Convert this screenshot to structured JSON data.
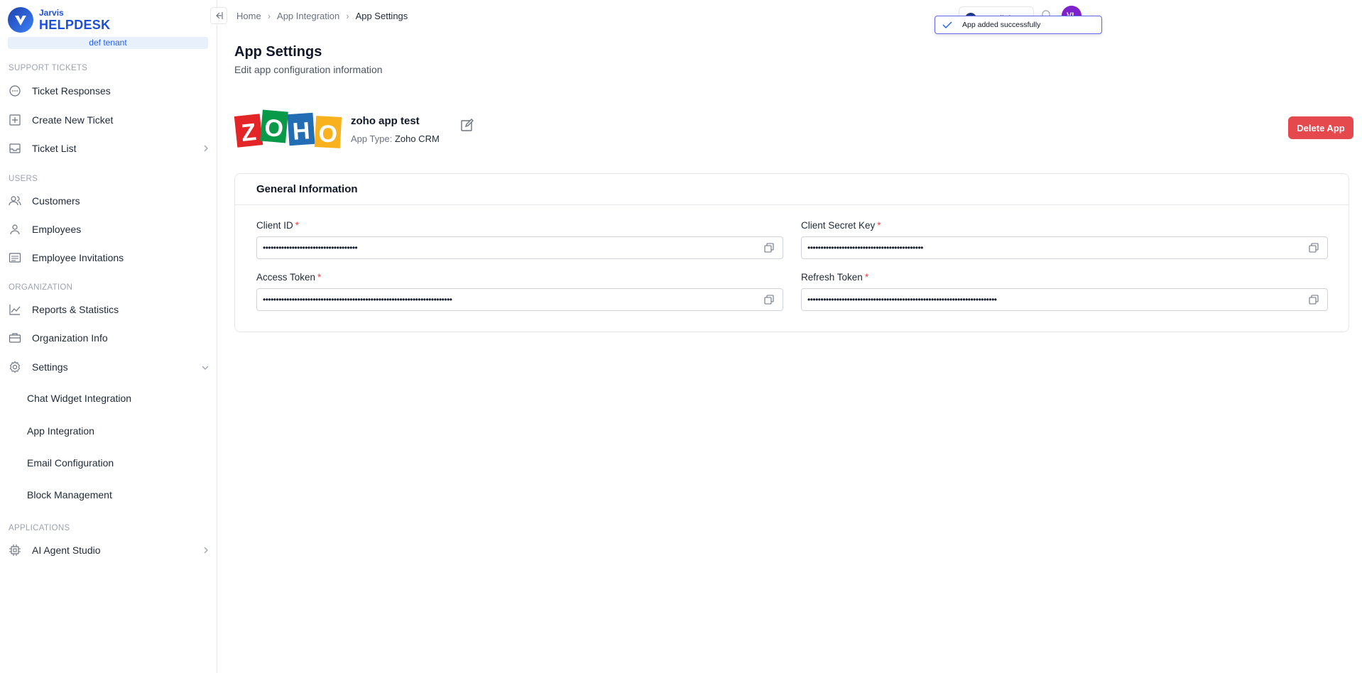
{
  "brand": {
    "small": "Jarvis",
    "big": "HELPDESK",
    "tenant": "def tenant"
  },
  "sidebar": {
    "sections": [
      "SUPPORT TICKETS",
      "USERS",
      "ORGANIZATION",
      "APPLICATIONS"
    ],
    "items": [
      {
        "label": "Ticket Responses",
        "icon": "chat-icon"
      },
      {
        "label": "Create New Ticket",
        "icon": "plus-square-icon"
      },
      {
        "label": "Ticket List",
        "icon": "inbox-icon"
      },
      {
        "label": "Customers",
        "icon": "users-icon"
      },
      {
        "label": "Employees",
        "icon": "user-icon"
      },
      {
        "label": "Employee Invitations",
        "icon": "list-icon"
      },
      {
        "label": "Reports & Statistics",
        "icon": "chart-line-icon"
      },
      {
        "label": "Organization Info",
        "icon": "briefcase-icon"
      },
      {
        "label": "Settings",
        "icon": "gear-icon"
      },
      {
        "label": "AI Agent Studio",
        "icon": "chip-icon"
      }
    ],
    "settings_sub": [
      "Chat Widget Integration",
      "App Integration",
      "Email Configuration",
      "Block Management"
    ]
  },
  "breadcrumb": {
    "home": "Home",
    "parent": "App Integration",
    "current": "App Settings"
  },
  "header": {
    "title": "App Settings",
    "subtitle": "Edit app configuration information"
  },
  "app": {
    "name": "zoho app test",
    "type_key": "App Type:",
    "type_value": "Zoho CRM",
    "delete_label": "Delete App",
    "logo_letters": [
      "Z",
      "O",
      "H",
      "O"
    ]
  },
  "card": {
    "title": "General Information",
    "fields": [
      {
        "label": "Client ID",
        "value": "••••••••••••••••••••••••••••••••••••"
      },
      {
        "label": "Client Secret Key",
        "value": "••••••••••••••••••••••••••••••••••••••••••••"
      },
      {
        "label": "Access Token",
        "value": "••••••••••••••••••••••••••••••••••••••••••••••••••••••••••••••••••••••••"
      },
      {
        "label": "Refresh Token",
        "value": "••••••••••••••••••••••••••••••••••••••••••••••••••••••••••••••••••••••••"
      }
    ]
  },
  "topbar": {
    "language": "English",
    "avatar": "VL"
  },
  "toast": {
    "message": "App added successfully"
  },
  "colors": {
    "primary": "#1d4ed8",
    "danger": "#e5484d",
    "toast_border": "#6366f1"
  }
}
